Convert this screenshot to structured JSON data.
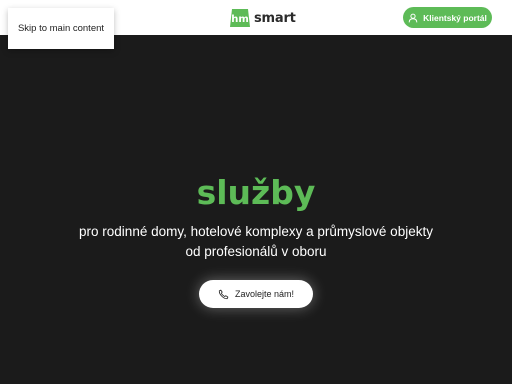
{
  "skip_link": {
    "label": "Skip to main content"
  },
  "header": {
    "logo_mark": "hm",
    "logo_text": "smart",
    "portal_button": {
      "label": "Klientský portál",
      "icon": "user-icon"
    }
  },
  "hero": {
    "title": "služby",
    "subtitle": "pro rodinné domy, hotelové komplexy a průmyslové objekty od profesionálů v oboru",
    "call_button": {
      "label": "Zavolejte nám!",
      "icon": "phone-icon"
    }
  },
  "colors": {
    "accent": "#5dbb57",
    "hero_background": "#1b1b1b",
    "header_background": "#ffffff"
  }
}
